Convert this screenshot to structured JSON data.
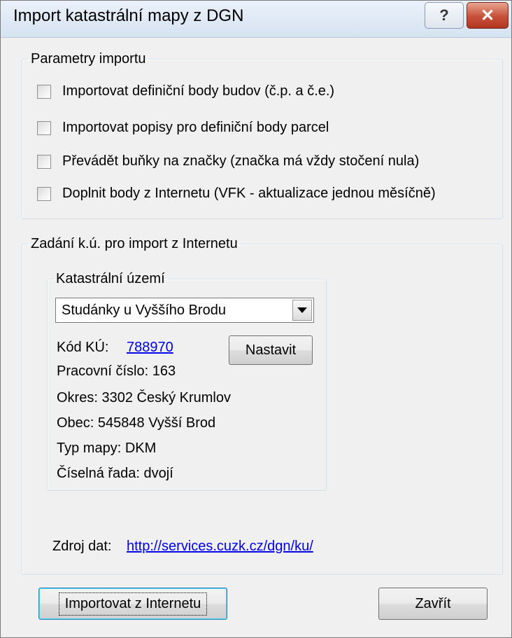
{
  "window": {
    "title": "Import katastrální mapy z DGN",
    "help_glyph": "?",
    "close_glyph": "✕"
  },
  "params": {
    "legend": "Parametry importu",
    "options": [
      {
        "label": "Importovat definiční body budov (č.p. a č.e.)",
        "checked": false
      },
      {
        "label": "Importovat popisy pro definiční body parcel",
        "checked": false
      },
      {
        "label": "Převádět buňky na značky (značka má vždy stočení nula)",
        "checked": false
      },
      {
        "label": "Doplnit body z Internetu (VFK - aktualizace jednou měsíčně)",
        "checked": false
      }
    ]
  },
  "internet": {
    "legend": "Zadání k.ú. pro import z Internetu",
    "ku_group": {
      "legend": "Katastrální území",
      "selected": "Studánky u Vyššího Brodu",
      "kod_label": "Kód KÚ:",
      "kod_value": "788970",
      "set_button": "Nastavit",
      "pracovni": "Pracovní číslo:  163",
      "okres": "Okres:   3302 Český Krumlov",
      "obec": "Obec:  545848 Vyšší Brod",
      "typ": "Typ mapy:  DKM",
      "rada": "Číselná řada:  dvojí"
    },
    "source_label": "Zdroj dat:",
    "source_url": "http://services.cuzk.cz/dgn/ku/"
  },
  "buttons": {
    "import": "Importovat z Internetu",
    "close": "Zavřít"
  }
}
